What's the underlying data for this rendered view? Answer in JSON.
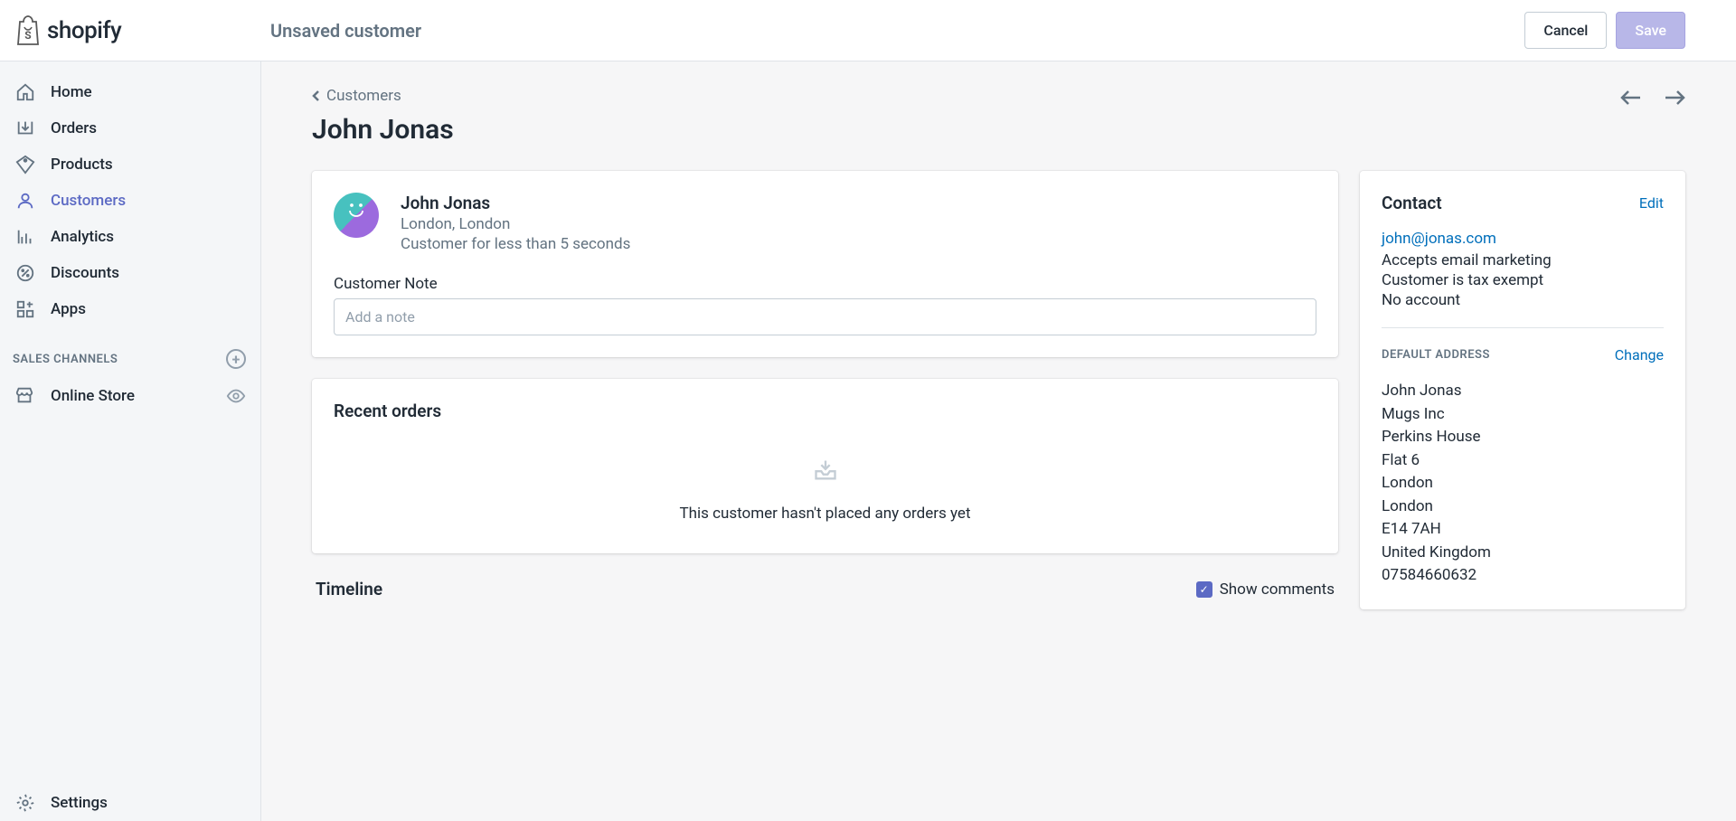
{
  "brand": "shopify",
  "topbar": {
    "title": "Unsaved customer",
    "cancel": "Cancel",
    "save": "Save"
  },
  "nav": {
    "home": "Home",
    "orders": "Orders",
    "products": "Products",
    "customers": "Customers",
    "analytics": "Analytics",
    "discounts": "Discounts",
    "apps": "Apps"
  },
  "sales_channels": {
    "header": "SALES CHANNELS",
    "online_store": "Online Store"
  },
  "settings": "Settings",
  "breadcrumb": "Customers",
  "page_title": "John Jonas",
  "customer": {
    "name": "John Jonas",
    "location": "London, London",
    "duration": "Customer for less than 5 seconds"
  },
  "note": {
    "label": "Customer Note",
    "placeholder": "Add a note"
  },
  "recent_orders": {
    "title": "Recent orders",
    "empty": "This customer hasn't placed any orders yet"
  },
  "contact": {
    "title": "Contact",
    "edit": "Edit",
    "email": "john@jonas.com",
    "marketing": "Accepts email marketing",
    "tax": "Customer is tax exempt",
    "account": "No account"
  },
  "address": {
    "header": "DEFAULT ADDRESS",
    "change": "Change",
    "name": "John Jonas",
    "company": "Mugs Inc",
    "line1": "Perkins House",
    "line2": "Flat 6",
    "city": "London",
    "region": "London",
    "postal": "E14 7AH",
    "country": "United Kingdom",
    "phone": "07584660632"
  },
  "timeline": {
    "title": "Timeline",
    "show_comments": "Show comments"
  }
}
